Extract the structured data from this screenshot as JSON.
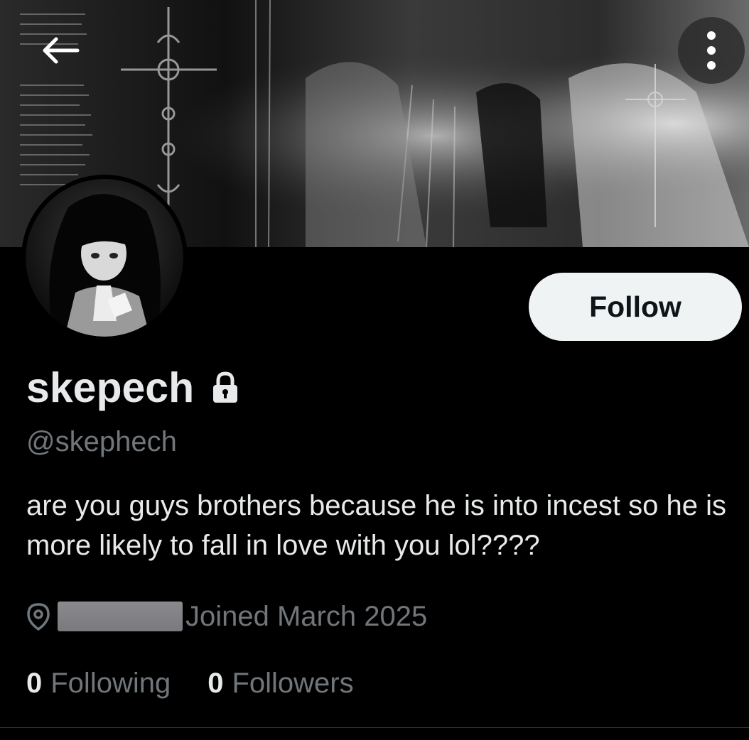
{
  "profile": {
    "display_name": "skepech",
    "handle": "@skephech",
    "bio": "are you guys brothers because he is into incest so he is more likely to fall in love with you lol????",
    "joined": "Joined March 2025",
    "locked": true
  },
  "actions": {
    "follow_label": "Follow"
  },
  "stats": {
    "following_count": "0",
    "following_label": "Following",
    "followers_count": "0",
    "followers_label": "Followers"
  },
  "icons": {
    "back": "arrow-left-icon",
    "more": "more-vertical-icon",
    "lock": "lock-icon",
    "location": "location-pin-icon"
  },
  "colors": {
    "background": "#000000",
    "primary_text": "#e7e9ea",
    "secondary_text": "#71767b",
    "button_bg": "#eff3f4",
    "button_text": "#0f1419"
  }
}
